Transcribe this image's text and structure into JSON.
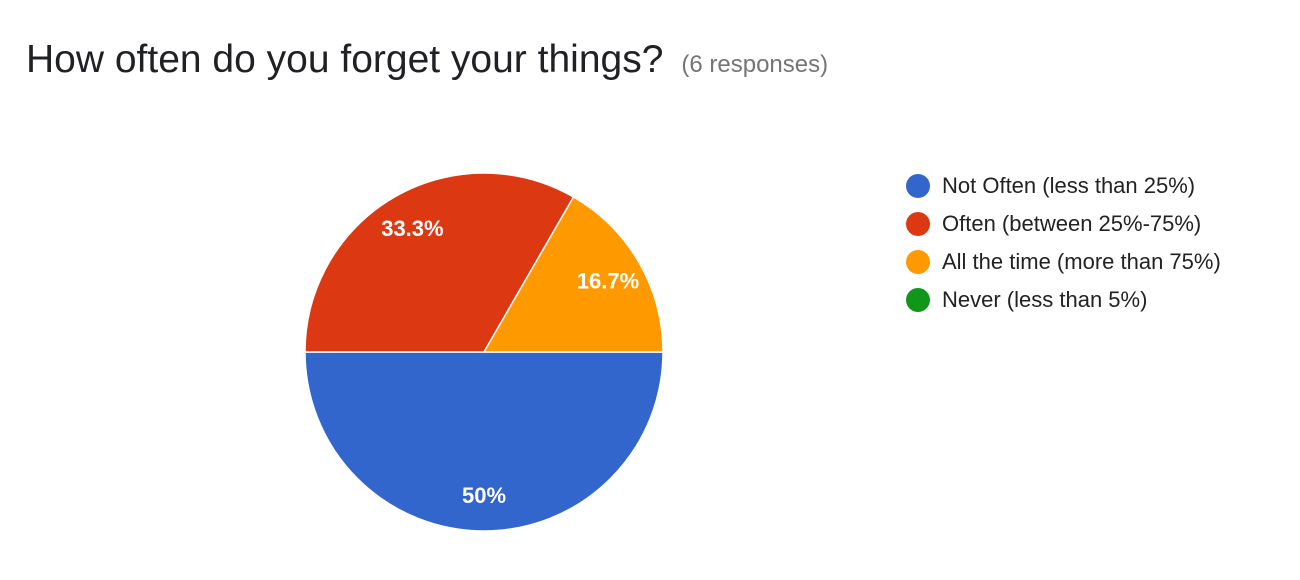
{
  "header": {
    "title": "How often do you forget your things?",
    "subtitle": "(6 responses)"
  },
  "chart_data": {
    "type": "pie",
    "title": "How often do you forget your things?",
    "subtitle": "(6 responses)",
    "legend_position": "right",
    "slices": [
      {
        "label": "Not Often (less than 25%)",
        "value": 3,
        "percent_label": "50%",
        "color": "#3366CC"
      },
      {
        "label": "Often (between 25%-75%)",
        "value": 2,
        "percent_label": "33.3%",
        "color": "#DC3912"
      },
      {
        "label": "All the time (more than 75%)",
        "value": 1,
        "percent_label": "16.7%",
        "color": "#FF9900"
      },
      {
        "label": "Never (less than 5%)",
        "value": 0,
        "percent_label": "",
        "color": "#109618"
      }
    ]
  }
}
